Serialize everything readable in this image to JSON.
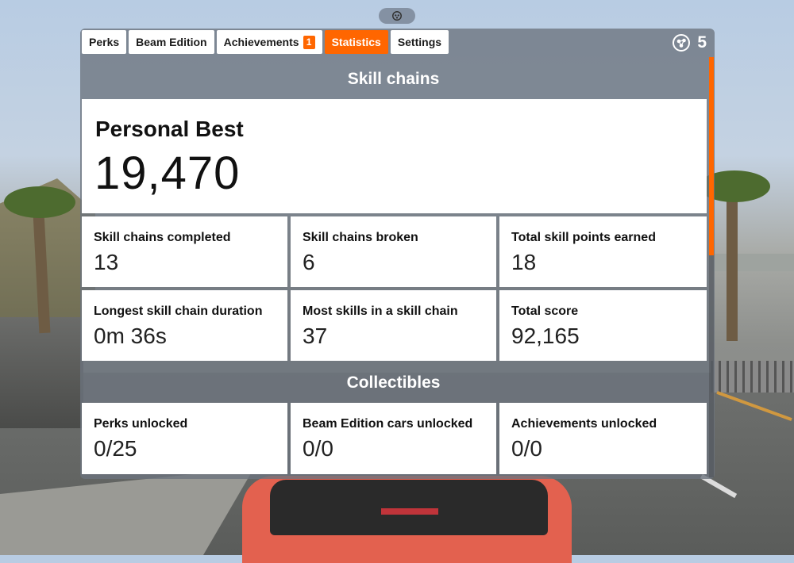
{
  "tabs": [
    {
      "label": "Perks",
      "active": false,
      "badge": ""
    },
    {
      "label": "Beam Edition",
      "active": false,
      "badge": ""
    },
    {
      "label": "Achievements",
      "active": false,
      "badge": "1"
    },
    {
      "label": "Statistics",
      "active": true,
      "badge": ""
    },
    {
      "label": "Settings",
      "active": false,
      "badge": ""
    }
  ],
  "skill_points": "5",
  "skill_chains": {
    "header": "Skill chains",
    "personal_best_label": "Personal Best",
    "personal_best_value": "19,470",
    "stats": [
      {
        "label": "Skill chains completed",
        "value": "13"
      },
      {
        "label": "Skill chains broken",
        "value": "6"
      },
      {
        "label": "Total skill points earned",
        "value": "18"
      },
      {
        "label": "Longest skill chain duration",
        "value": "0m 36s"
      },
      {
        "label": "Most skills in a skill chain",
        "value": "37"
      },
      {
        "label": "Total score",
        "value": "92,165"
      }
    ]
  },
  "collectibles": {
    "header": "Collectibles",
    "stats": [
      {
        "label": "Perks unlocked",
        "value": "0/25"
      },
      {
        "label": "Beam Edition cars unlocked",
        "value": "0/0"
      },
      {
        "label": "Achievements unlocked",
        "value": "0/0"
      }
    ]
  },
  "colors": {
    "accent": "#ff6600",
    "panel": "#6c737d",
    "card": "#ffffff"
  },
  "icons": {
    "points": "skill-points-icon",
    "handle": "drag-handle-icon"
  }
}
